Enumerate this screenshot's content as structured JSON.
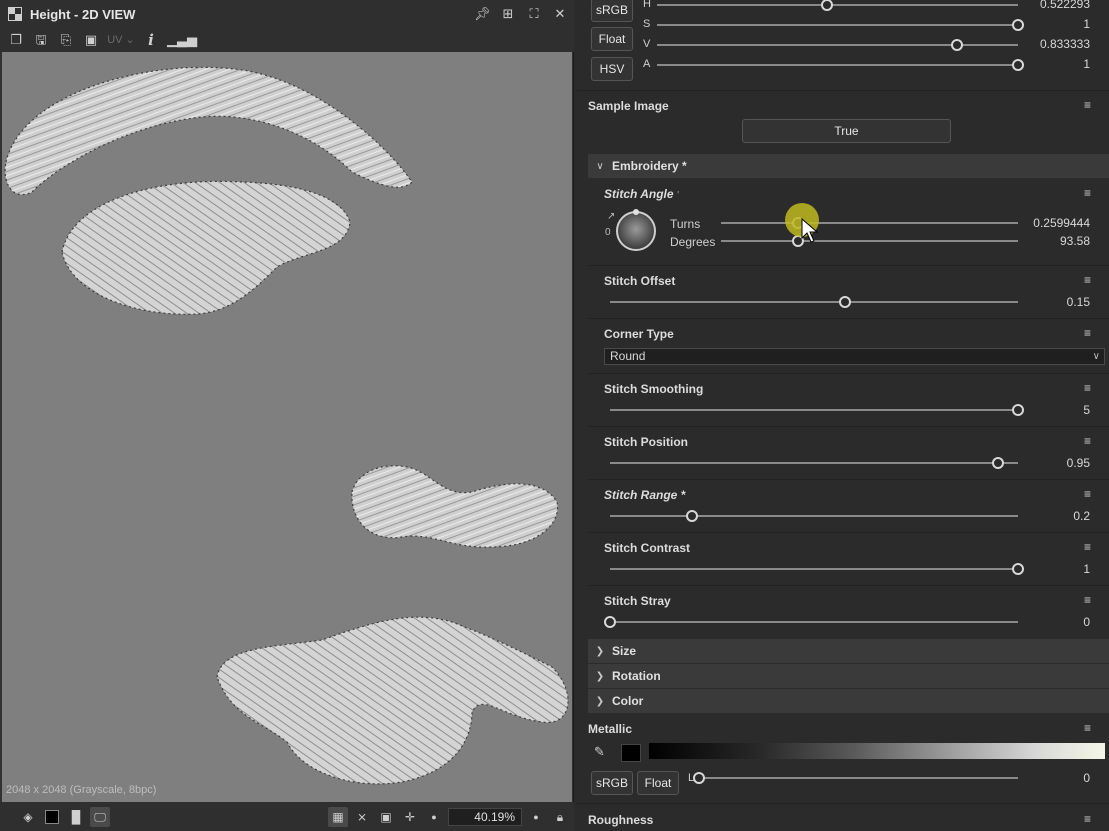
{
  "view2d": {
    "title": "Height - 2D VIEW",
    "toolbar": {
      "uv_label": "UV",
      "info_label": "i"
    },
    "resolution_info": "2048 x 2048 (Grayscale, 8bpc)",
    "zoom": "40.19%"
  },
  "color_block": {
    "buttons": [
      "sRGB",
      "Float",
      "HSV"
    ],
    "channels": [
      {
        "label": "H",
        "value": "0.522293",
        "fraction": 0.47
      },
      {
        "label": "S",
        "value": "1",
        "fraction": 1.0
      },
      {
        "label": "V",
        "value": "0.833333",
        "fraction": 0.83
      },
      {
        "label": "A",
        "value": "1",
        "fraction": 1.0
      }
    ]
  },
  "sample_image": {
    "title": "Sample Image",
    "button": "True"
  },
  "embroidery": {
    "header": "Embroidery *",
    "stitch_angle": {
      "title": "Stitch Angle",
      "title_marker": "'",
      "dial_zero": "0",
      "turns_label": "Turns",
      "turns_value": "0.2599444",
      "degrees_label": "Degrees",
      "degrees_value": "93.58",
      "fraction": 0.26
    },
    "params": [
      {
        "id": "stitch-offset",
        "title": "Stitch Offset",
        "value": "0.15",
        "fraction": 0.575,
        "italic": false
      },
      {
        "id": "stitch-smoothing",
        "title": "Stitch Smoothing",
        "value": "5",
        "fraction": 1.0,
        "italic": false
      },
      {
        "id": "stitch-position",
        "title": "Stitch Position",
        "value": "0.95",
        "fraction": 0.95,
        "italic": false
      },
      {
        "id": "stitch-range",
        "title": "Stitch Range *",
        "value": "0.2",
        "fraction": 0.2,
        "italic": true
      },
      {
        "id": "stitch-contrast",
        "title": "Stitch Contrast",
        "value": "1",
        "fraction": 1.0,
        "italic": false
      },
      {
        "id": "stitch-stray",
        "title": "Stitch Stray",
        "value": "0",
        "fraction": 0.0,
        "italic": false
      }
    ],
    "corner_type": {
      "title": "Corner Type",
      "value": "Round"
    }
  },
  "collapsed_groups": [
    "Size",
    "Rotation",
    "Color"
  ],
  "metallic": {
    "title": "Metallic",
    "buttons": [
      "sRGB",
      "Float"
    ],
    "channel_label": "L",
    "value": "0",
    "fraction": 0.0
  },
  "roughness": {
    "title": "Roughness"
  }
}
